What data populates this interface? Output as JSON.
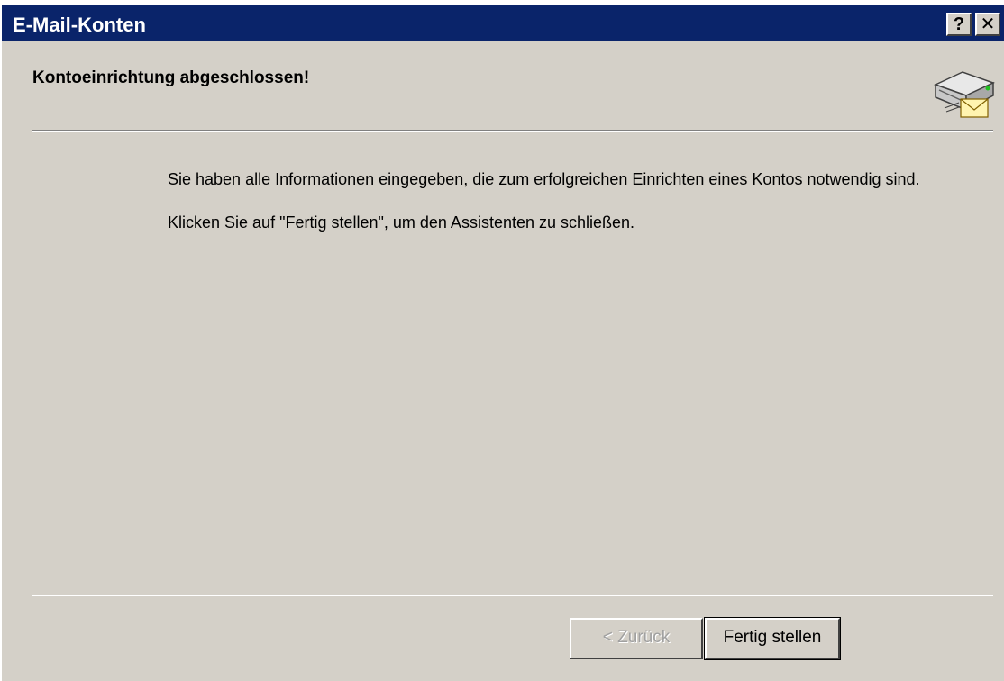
{
  "window": {
    "title": "E-Mail-Konten",
    "help_button": "?",
    "close_button": "✕"
  },
  "header": {
    "title": "Kontoeinrichtung abgeschlossen!",
    "icon": "mail-server-icon"
  },
  "body": {
    "paragraph1": "Sie haben alle Informationen eingegeben, die zum erfolgreichen Einrichten eines Kontos notwendig sind.",
    "paragraph2": "Klicken Sie auf \"Fertig stellen\", um den Assistenten zu schließen."
  },
  "buttons": {
    "back_label": "< Zurück",
    "back_enabled": false,
    "finish_label": "Fertig stellen"
  },
  "colors": {
    "titlebar": "#0a246a",
    "dialog_background": "#d4d0c8",
    "disabled_text": "#a0a0a0"
  }
}
